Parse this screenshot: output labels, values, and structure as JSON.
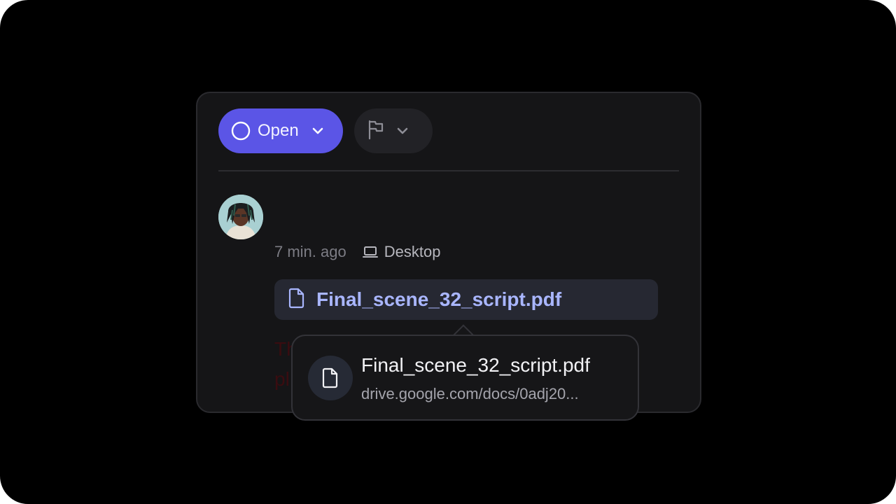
{
  "status_button": {
    "label": "Open",
    "icon": "circle-icon",
    "color": "#5b55e6"
  },
  "flag_button": {
    "icon": "flag-icon"
  },
  "comment": {
    "time": "7 min. ago",
    "device": "Desktop",
    "device_icon": "laptop-icon",
    "attachment": {
      "name": "Final_scene_32_script.pdf",
      "icon": "file-icon"
    },
    "body_line1": "Th",
    "body_line2": "pl"
  },
  "tooltip": {
    "title": "Final_scene_32_script.pdf",
    "url": "drive.google.com/docs/0adj20...",
    "icon": "file-icon"
  },
  "colors": {
    "accent": "#5b55e6",
    "link": "#a9b6ff",
    "card_bg": "#151517"
  }
}
